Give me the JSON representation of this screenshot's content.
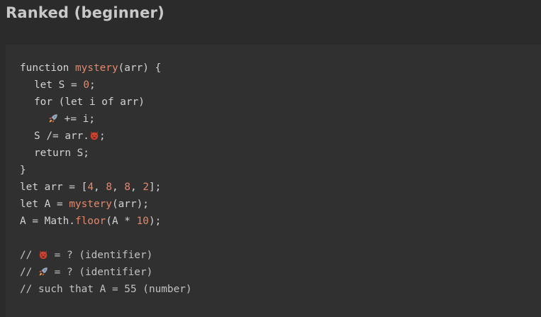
{
  "header": {
    "title": "Ranked (beginner)"
  },
  "code": {
    "line1": {
      "kw": "function ",
      "fn": "mystery",
      "rest": "(arr) {"
    },
    "line2": {
      "a": "let S = ",
      "num": "0",
      "b": ";"
    },
    "line3": {
      "text": "for (let i of arr)"
    },
    "line4": {
      "rest": " += i;",
      "icon": "rocket-icon"
    },
    "line5": {
      "a": "S /= arr.",
      "b": ";",
      "icon": "devil-face-icon"
    },
    "line6": {
      "text": "return S;"
    },
    "line7": {
      "text": "}"
    },
    "line8": {
      "a": "let arr = [",
      "n1": "4",
      "s1": ", ",
      "n2": "8",
      "s2": ", ",
      "n3": "8",
      "s3": ", ",
      "n4": "2",
      "b": "];"
    },
    "line9": {
      "a": "let A = ",
      "fn": "mystery",
      "b": "(arr);"
    },
    "line10": {
      "a": "A = Math.",
      "fn": "floor",
      "b": "(A * ",
      "num": "10",
      "c": ");"
    },
    "line12": {
      "a": "// ",
      "rest": " = ? (identifier)",
      "icon": "devil-face-icon"
    },
    "line13": {
      "a": "// ",
      "rest": " = ? (identifier)",
      "icon": "rocket-icon"
    },
    "line14": {
      "text": "// such that A = 55 (number)"
    }
  },
  "colors": {
    "background": "#2b2b2b",
    "panel": "#303030",
    "text": "#d3d3d3",
    "accent": "#e5886a"
  }
}
